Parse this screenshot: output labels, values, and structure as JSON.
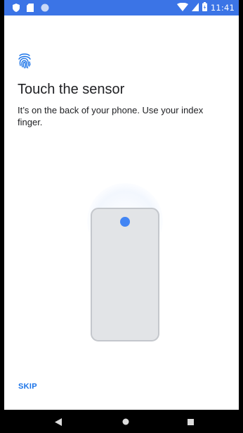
{
  "status_bar": {
    "time": "11:41",
    "bg_color": "#3b74e6",
    "left_icons": [
      "shield-icon",
      "sd-card-icon",
      "circle-icon"
    ],
    "right_icons": [
      "wifi-icon",
      "signal-icon",
      "battery-icon"
    ]
  },
  "page": {
    "icon": "fingerprint-icon",
    "title": "Touch the sensor",
    "description": "It’s on the back of your phone. Use your index finger."
  },
  "illustration": {
    "accent_color": "#4285f4"
  },
  "actions": {
    "skip_label": "SKIP"
  },
  "nav_bar": {
    "buttons": [
      "back-icon",
      "home-icon",
      "recents-icon"
    ]
  }
}
